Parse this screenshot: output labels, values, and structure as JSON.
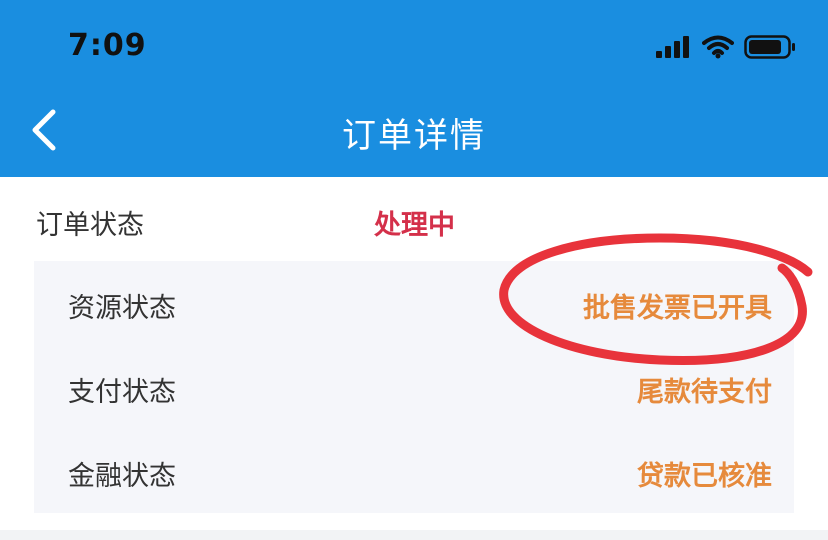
{
  "status_bar": {
    "time": "7:09",
    "icons": [
      "signal-icon",
      "wifi-icon",
      "battery-icon"
    ]
  },
  "header": {
    "back_icon": "chevron-left-icon",
    "title": "订单详情"
  },
  "order": {
    "label": "订单状态",
    "value": "处理中"
  },
  "details": [
    {
      "label": "资源状态",
      "value": "批售发票已开具"
    },
    {
      "label": "支付状态",
      "value": "尾款待支付"
    },
    {
      "label": "金融状态",
      "value": "贷款已核准"
    }
  ],
  "colors": {
    "header_bg": "#1a8ee0",
    "processing": "#d4304a",
    "status_value": "#e68a3c",
    "annotation": "#e8333b"
  }
}
